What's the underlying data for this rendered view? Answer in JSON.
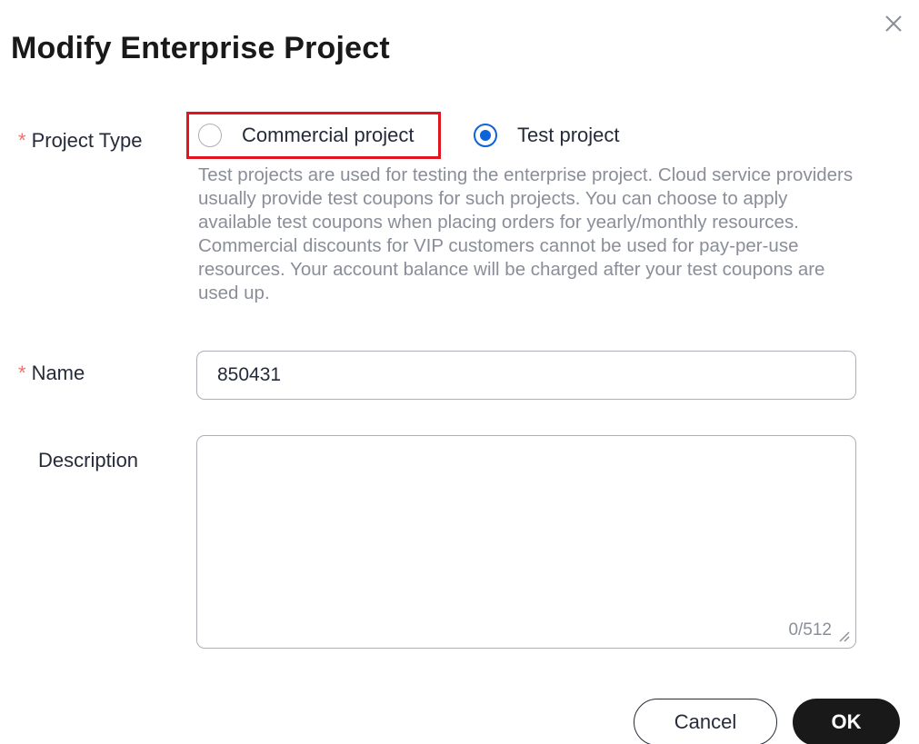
{
  "dialog": {
    "title": "Modify Enterprise Project",
    "close_icon": "close-icon"
  },
  "form": {
    "project_type": {
      "label": "Project Type",
      "required_mark": "*",
      "options": [
        {
          "label": "Commercial project",
          "selected": false,
          "highlighted": true
        },
        {
          "label": "Test project",
          "selected": true,
          "highlighted": false
        }
      ],
      "help_text": "Test projects are used for testing the enterprise project. Cloud service providers usually provide test coupons for such projects. You can choose to apply available test coupons when placing orders for yearly/monthly resources. Commercial discounts for VIP customers cannot be used for pay-per-use resources. Your account balance will be charged after your test coupons are used up."
    },
    "name": {
      "label": "Name",
      "required_mark": "*",
      "value": "850431"
    },
    "description": {
      "label": "Description",
      "value": "",
      "char_count": "0/512"
    }
  },
  "footer": {
    "cancel_label": "Cancel",
    "ok_label": "OK"
  },
  "colors": {
    "accent": "#0d63d8",
    "required": "#f66f6a",
    "highlight_border": "#e0151f",
    "primary_button": "#191919"
  }
}
